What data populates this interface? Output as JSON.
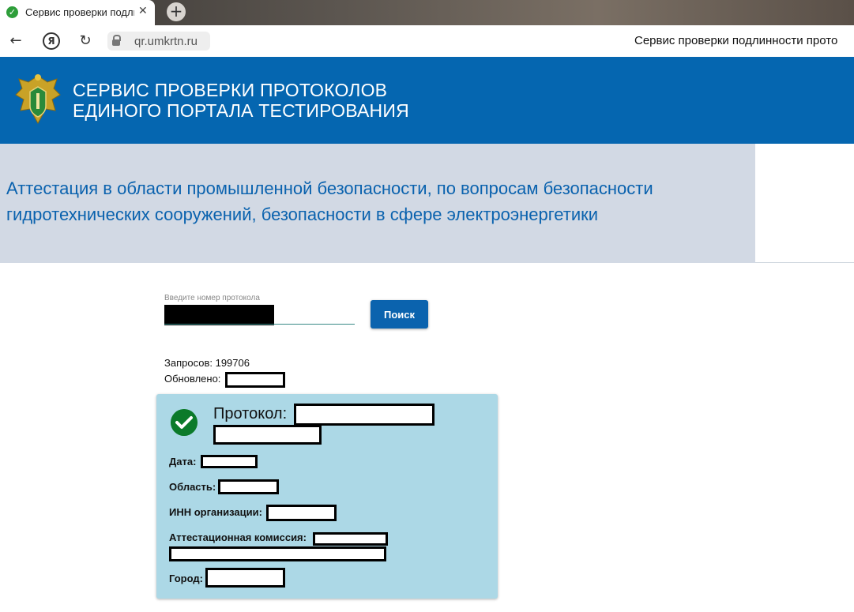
{
  "browser": {
    "tab_title": "Сервис проверки подлинн",
    "tab_favicon": "✓",
    "tab_close": "✕",
    "new_tab": "+",
    "back": "←",
    "yandex": "Я",
    "reload": "↻",
    "url": "qr.umkrtn.ru",
    "page_title": "Сервис проверки подлинности прото"
  },
  "header": {
    "title_line1": "СЕРВИС ПРОВЕРКИ ПРОТОКОЛОВ",
    "title_line2": "ЕДИНОГО ПОРТАЛА ТЕСТИРОВАНИЯ"
  },
  "banner": {
    "title": "Аттестация в области промышленной безопасности, по вопросам безопасности гидротехнических сооружений, безопасности в сфере электроэнергетики"
  },
  "search": {
    "label": "Введите номер протокола",
    "button": "Поиск"
  },
  "stats": {
    "requests": "Запросов: 199706",
    "updated_label": "Обновлено:"
  },
  "result": {
    "protocol_label": "Протокол:",
    "date_label": "Дата:",
    "region_label": "Область:",
    "inn_label": "ИНН организации:",
    "commission_label": "Аттестационная комиссия:",
    "city_label": "Город:"
  },
  "colors": {
    "header_blue": "#0566b0",
    "banner_bg": "#d2d9e4",
    "card_bg": "#acd8e6",
    "check_green": "#0b7a2a"
  }
}
